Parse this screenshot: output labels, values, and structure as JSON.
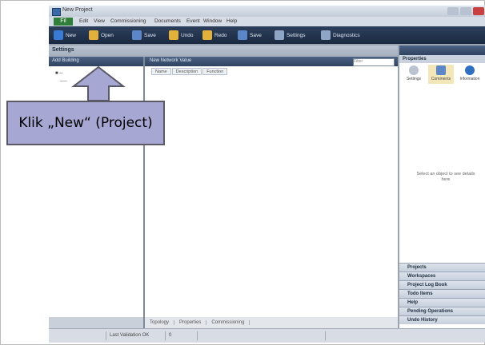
{
  "window": {
    "title": "New Project"
  },
  "menu": {
    "file_label": "Fil",
    "items": [
      "Edit",
      "View",
      "Commissioning",
      "Documents",
      "Event",
      "Window",
      "Help"
    ]
  },
  "toolbar": {
    "items": [
      {
        "label": "New",
        "icon": "new-project-icon",
        "color": "#3a7bd5"
      },
      {
        "label": "Open",
        "icon": "open-folder-icon",
        "color": "#e2b13c"
      },
      {
        "label": "Save",
        "icon": "save-icon",
        "color": "#5b87c8"
      },
      {
        "label": "Undo",
        "icon": "undo-icon",
        "color": "#e2b13c"
      },
      {
        "label": "Redo",
        "icon": "redo-icon",
        "color": "#e2b13c"
      },
      {
        "label": "Save",
        "icon": "disk-icon",
        "color": "#5b87c8"
      },
      {
        "label": "Settings",
        "icon": "settings-icon",
        "color": "#8fa5c6"
      },
      {
        "label": "Diagnostics",
        "icon": "diagnostics-icon",
        "color": "#8fa5c6"
      }
    ]
  },
  "settings_panel": {
    "title": "Settings",
    "left_toolbar_label": "Add Building",
    "main_toolbar_label": "New Network Value",
    "search_placeholder": "Filter",
    "columns": [
      "Name",
      "Description",
      "Function"
    ],
    "bottom_tabs": [
      "Topology",
      "Properties",
      "Commissioning"
    ]
  },
  "properties_panel": {
    "title": "Properties",
    "tabs": [
      "Settings",
      "Comments",
      "Information"
    ],
    "empty_message": "Select an object to see details here"
  },
  "accordion": [
    "Projects",
    "Workspaces",
    "Project Log Book",
    "Todo Items",
    "Help",
    "Pending Operations",
    "Undo History"
  ],
  "status_bar": {
    "left_text": "Last Validation OK",
    "right_text": "0"
  },
  "annotation": {
    "text": "Klik „New“ (Project)"
  },
  "colors": {
    "toolbar_bg": "#1b2a42",
    "callout_bg": "#a7a7d4",
    "accent": "#2f7f3a"
  }
}
